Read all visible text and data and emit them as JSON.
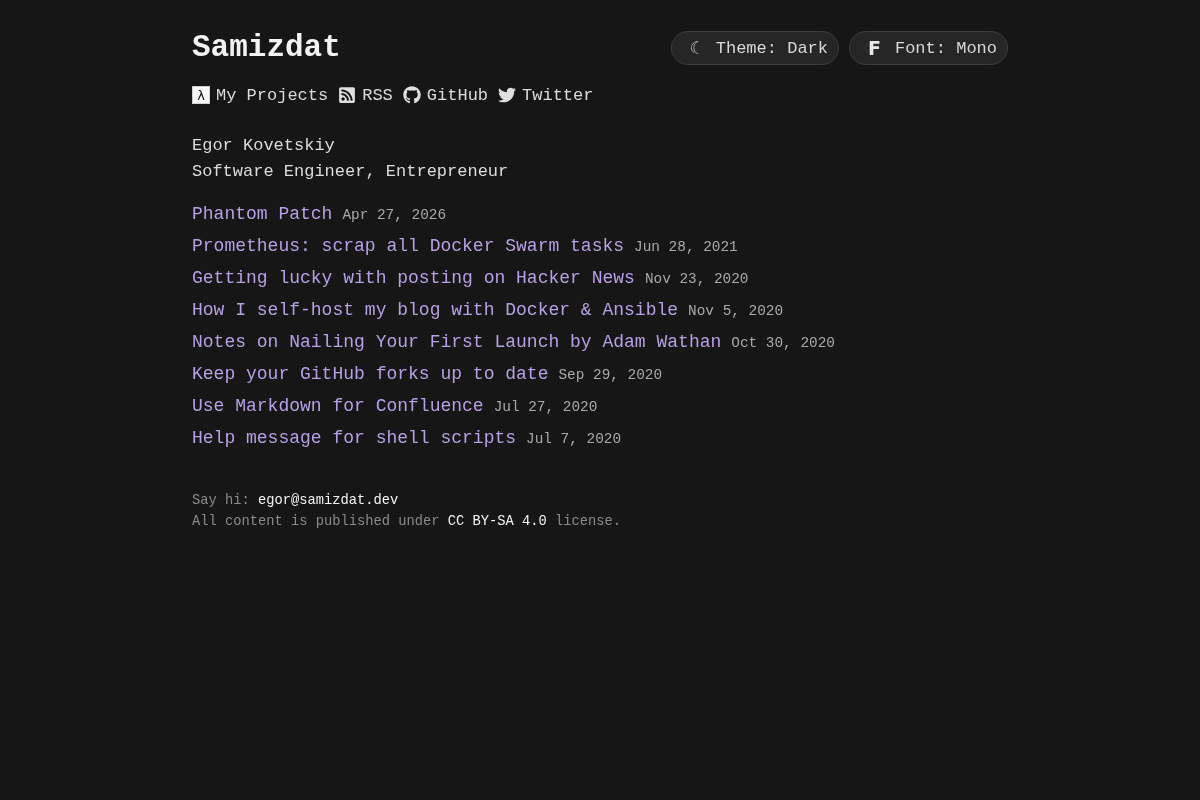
{
  "header": {
    "title": "Samizdat",
    "buttons": [
      {
        "kind": "theme",
        "icon": "☾",
        "label": "Theme: Dark"
      },
      {
        "kind": "font",
        "icon": "F",
        "label": "Font: Mono"
      }
    ]
  },
  "nav": [
    {
      "kind": "lambda",
      "icon": "λ",
      "label": "My Projects"
    },
    {
      "kind": "rss",
      "label": "RSS"
    },
    {
      "kind": "github",
      "label": "GitHub"
    },
    {
      "kind": "twitter",
      "label": "Twitter"
    }
  ],
  "profile": {
    "name": "Egor Kovetskiy",
    "tagline": "Software Engineer, Entrepreneur"
  },
  "posts": [
    {
      "title": "Phantom Patch",
      "date": "Apr 27, 2026"
    },
    {
      "title": "Prometheus: scrap all Docker Swarm tasks",
      "date": "Jun 28, 2021"
    },
    {
      "title": "Getting lucky with posting on Hacker News",
      "date": "Nov 23, 2020"
    },
    {
      "title": "How I self-host my blog with Docker & Ansible",
      "date": "Nov 5, 2020"
    },
    {
      "title": "Notes on Nailing Your First Launch by Adam Wathan",
      "date": "Oct 30, 2020"
    },
    {
      "title": "Keep your GitHub forks up to date",
      "date": "Sep 29, 2020"
    },
    {
      "title": "Use Markdown for Confluence",
      "date": "Jul 27, 2020"
    },
    {
      "title": "Help message for shell scripts",
      "date": "Jul 7, 2020"
    }
  ],
  "footer": {
    "contact": {
      "text": "Say hi:",
      "link": "egor@samizdat.dev"
    },
    "license": {
      "before": "All content is published under",
      "link": "CC BY-SA 4.0",
      "after": "license."
    }
  }
}
